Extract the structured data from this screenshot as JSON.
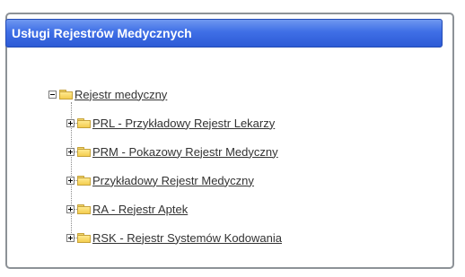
{
  "panel": {
    "title": "Usługi Rejestrów Medycznych"
  },
  "tree": {
    "root": {
      "label": "Rejestr medyczny",
      "expanded": true
    },
    "children": [
      {
        "label": "PRL - Przykładowy Rejestr Lekarzy",
        "expanded": false
      },
      {
        "label": "PRM - Pokazowy Rejestr Medyczny",
        "expanded": false
      },
      {
        "label": "Przykładowy Rejestr Medyczny",
        "expanded": false
      },
      {
        "label": "RA - Rejestr Aptek",
        "expanded": false
      },
      {
        "label": "RSK - Rejestr Systemów Kodowania",
        "expanded": false
      }
    ]
  }
}
